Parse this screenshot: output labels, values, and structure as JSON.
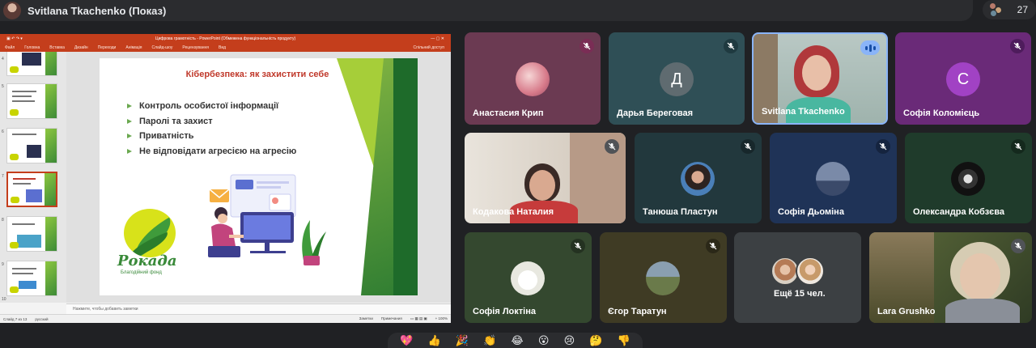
{
  "header": {
    "presenter_title": "Svitlana Tkachenko (Показ)",
    "participant_count": "27"
  },
  "presentation": {
    "window_title": "Цифрова грамотність - PowerPoint (Обмежена функціональність продукту)",
    "account": "",
    "ribbon_tabs": [
      "Файл",
      "Головна",
      "Вставка",
      "Дизайн",
      "Переходи",
      "Анімація",
      "Слайд-шоу",
      "Рецензування",
      "Вид"
    ],
    "share_label": "Спільний доступ",
    "slide_numbers": [
      "4",
      "5",
      "6",
      "7",
      "8",
      "9",
      "10"
    ],
    "slide": {
      "title": "Кібербезпека: як захистити себе",
      "bullets": [
        "Контроль особистої інформації",
        "Паролі та захист",
        "Приватність",
        "Не відповідати агресією на агресію"
      ],
      "logo_name": "Рокада",
      "logo_subtitle": "Благодійний фонд"
    },
    "notes_placeholder": "Нажмите, чтобы добавить заметки",
    "status_left": "Слайд 7 из 13",
    "status_lang": "русский",
    "status_notes": "Заметки",
    "status_comments": "Примечания",
    "zoom": "+ 100%"
  },
  "tiles": [
    {
      "name": "Анастасия Крип"
    },
    {
      "name": "Дарья Береговая",
      "initial": "Д"
    },
    {
      "name": "Svitlana Tkachenko"
    },
    {
      "name": "Софія Коломієць",
      "initial": "С"
    },
    {
      "name": "Кодакова Наталия"
    },
    {
      "name": "Танюша Пластун"
    },
    {
      "name": "Софія Дьоміна"
    },
    {
      "name": "Олександра Кобзєва"
    },
    {
      "name": "Софія Локтіна"
    },
    {
      "name": "Єгор Таратун"
    },
    {
      "name": "Ещё 15 чел."
    },
    {
      "name": "Lara Grushko"
    }
  ],
  "colors": {
    "background": "#202124",
    "tile_dark": "#3c4043",
    "speaking": "#8ab4f8",
    "powerpoint": "#c43e1c"
  },
  "reactions": [
    "💖",
    "👍",
    "🎉",
    "👏",
    "😂",
    "😮",
    "😢",
    "🤔",
    "👎"
  ]
}
